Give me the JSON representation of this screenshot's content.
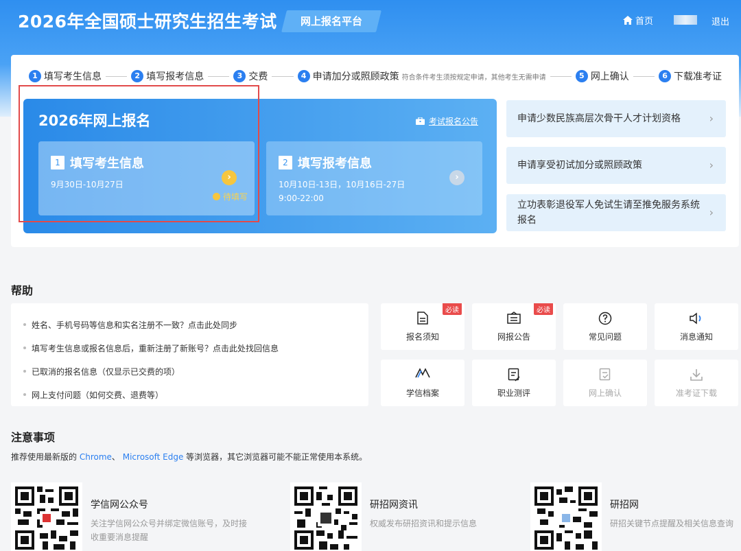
{
  "header": {
    "title": "2026年全国硕士研究生招生考试",
    "platform": "网上报名平台",
    "home": "首页",
    "logout": "退出"
  },
  "steps": [
    {
      "num": "1",
      "label": "填写考生信息"
    },
    {
      "num": "2",
      "label": "填写报考信息"
    },
    {
      "num": "3",
      "label": "交费"
    },
    {
      "num": "4",
      "label": "申请加分或照顾政策",
      "note": "符合条件考生须按规定申请，其他考生无需申请"
    },
    {
      "num": "5",
      "label": "网上确认"
    },
    {
      "num": "6",
      "label": "下载准考证"
    }
  ],
  "registration": {
    "title": "2026年网上报名",
    "notice_link": "考试报名公告",
    "cards": [
      {
        "num": "1",
        "title": "填写考生信息",
        "dates": "9月30日-10月27日",
        "time": "",
        "status": "待填写"
      },
      {
        "num": "2",
        "title": "填写报考信息",
        "dates": "10月10日-13日，10月16日-27日",
        "time": "9:00-22:00",
        "status": ""
      }
    ]
  },
  "side_links": [
    "申请少数民族高层次骨干人才计划资格",
    "申请享受初试加分或照顾政策",
    "立功表彰退役军人免试生请至推免服务系统报名"
  ],
  "help": {
    "title": "帮助",
    "items": [
      "姓名、手机号码等信息和实名注册不一致？点击此处同步",
      "填写考生信息或报名信息后，重新注册了新账号？点击此处找回信息",
      "已取消的报名信息（仅显示已交费的项）",
      "网上支付问题（如何交费、退费等）"
    ],
    "tiles": [
      {
        "label": "报名须知",
        "icon": "document-icon",
        "badge": "必读"
      },
      {
        "label": "网报公告",
        "icon": "notice-icon",
        "badge": "必读"
      },
      {
        "label": "常见问题",
        "icon": "question-icon",
        "badge": ""
      },
      {
        "label": "消息通知",
        "icon": "speaker-icon",
        "badge": ""
      },
      {
        "label": "学信档案",
        "icon": "archive-icon",
        "badge": ""
      },
      {
        "label": "职业测评",
        "icon": "assessment-icon",
        "badge": ""
      },
      {
        "label": "网上确认",
        "icon": "confirm-icon",
        "badge": ""
      },
      {
        "label": "准考证下载",
        "icon": "download-icon",
        "badge": ""
      }
    ]
  },
  "notice": {
    "title": "注意事项",
    "text_before": "推荐使用最新版的 ",
    "chrome": "Chrome",
    "sep": "、 ",
    "edge": "Microsoft Edge",
    "text_after": " 等浏览器，其它浏览器可能不能正常使用本系统。"
  },
  "qr_codes": [
    {
      "title": "学信网公众号",
      "desc": "关注学信网公众号并绑定微信账号，及时接收重要消息提醒"
    },
    {
      "title": "研招网资讯",
      "desc": "权威发布研招资讯和提示信息"
    },
    {
      "title": "研招网",
      "desc": "研招关键节点提醒及相关信息查询"
    }
  ],
  "colors": {
    "primary": "#2b7ff0",
    "badge": "#e94b4b",
    "highlight": "#e24a4a",
    "pending": "#f6c63f"
  }
}
